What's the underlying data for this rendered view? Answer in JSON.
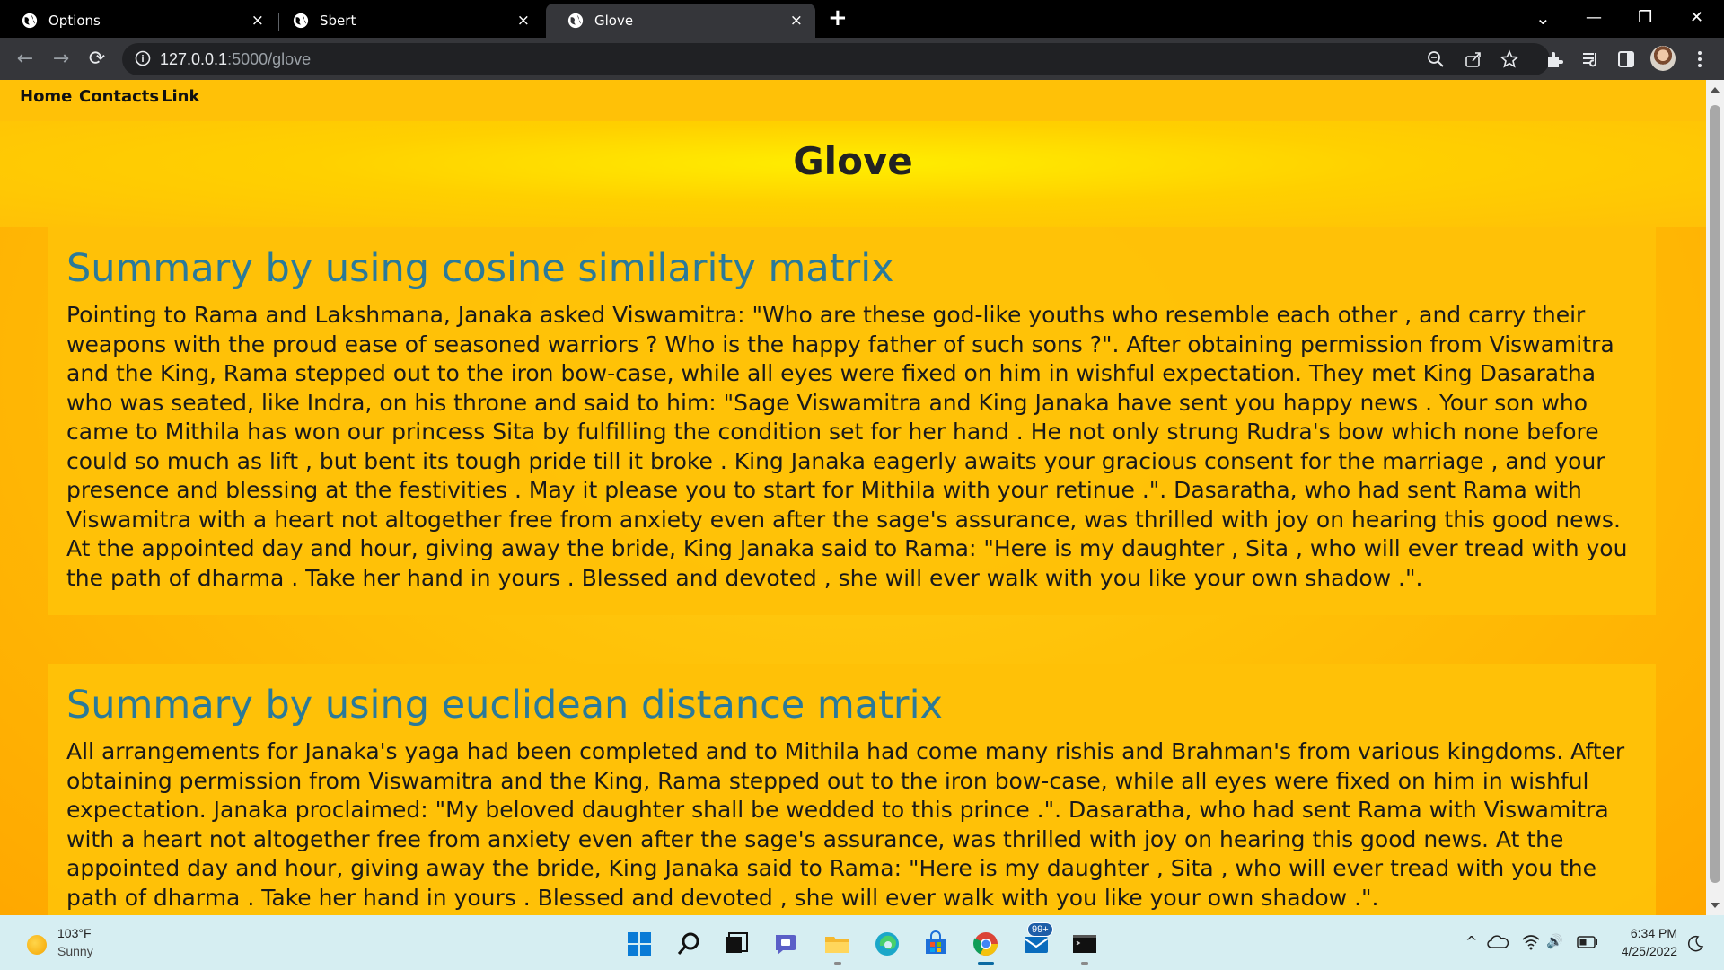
{
  "browser": {
    "tabs": [
      {
        "title": "Options",
        "active": false,
        "icon": "globe-icon"
      },
      {
        "title": "Sbert",
        "active": false,
        "icon": "globe-icon"
      },
      {
        "title": "Glove",
        "active": true,
        "icon": "globe-icon"
      }
    ],
    "close_glyph": "×",
    "new_tab_glyph": "+",
    "window_controls": {
      "tab_search": "⌄",
      "minimize": "—",
      "restore": "❐",
      "close": "✕"
    },
    "address": {
      "host": "127.0.0.1",
      "rest": ":5000/glove"
    },
    "nav_glyphs": {
      "back": "←",
      "forward": "→",
      "reload": "⟳"
    }
  },
  "page": {
    "nav": [
      "Home",
      "Contacts",
      "Link"
    ],
    "title": "Glove",
    "sections": [
      {
        "heading": "Summary by using cosine similarity matrix",
        "body": "Pointing to Rama and Lakshmana, Janaka asked Viswamitra: \"Who are these god-like youths who resemble each other , and carry their weapons with the proud ease of seasoned warriors ? Who is the happy father of such sons ?\". After obtaining permission from Viswamitra and the King, Rama stepped out to the iron bow-case, while all eyes were fixed on him in wishful expectation. They met King Dasaratha who was seated, like Indra, on his throne and said to him: \"Sage Viswamitra and King Janaka have sent you happy news . Your son who came to Mithila has won our princess Sita by fulfilling the condition set for her hand . He not only strung Rudra's bow which none before could so much as lift , but bent its tough pride till it broke . King Janaka eagerly awaits your gracious consent for the marriage , and your presence and blessing at the festivities . May it please you to start for Mithila with your retinue .\". Dasaratha, who had sent Rama with Viswamitra with a heart not altogether free from anxiety even after the sage's assurance, was thrilled with joy on hearing this good news. At the appointed day and hour, giving away the bride, King Janaka said to Rama: \"Here is my daughter , Sita , who will ever tread with you the path of dharma . Take her hand in yours . Blessed and devoted , she will ever walk with you like your own shadow .\"."
      },
      {
        "heading": "Summary by using euclidean distance matrix",
        "body": "All arrangements for Janaka's yaga had been completed and to Mithila had come many rishis and Brahman's from various kingdoms. After obtaining permission from Viswamitra and the King, Rama stepped out to the iron bow-case, while all eyes were fixed on him in wishful expectation. Janaka proclaimed: \"My beloved daughter shall be wedded to this prince .\". Dasaratha, who had sent Rama with Viswamitra with a heart not altogether free from anxiety even after the sage's assurance, was thrilled with joy on hearing this good news. At the appointed day and hour, giving away the bride, King Janaka said to Rama: \"Here is my daughter , Sita , who will ever tread with you the path of dharma . Take her hand in yours . Blessed and devoted , she will ever walk with you like your own shadow .\"."
      }
    ]
  },
  "taskbar": {
    "weather": {
      "temp": "103°F",
      "condition": "Sunny"
    },
    "notification_badge": "99+",
    "tray_glyphs": {
      "chevron": "^",
      "speaker": "🔊"
    },
    "clock": {
      "time": "6:34 PM",
      "date": "4/25/2022"
    }
  },
  "colors": {
    "page_background": "#ffc107",
    "section_heading": "#2b7a99",
    "chrome_dark": "#35363a",
    "tab_strip": "#000000",
    "taskbar": "#d6eef2"
  }
}
